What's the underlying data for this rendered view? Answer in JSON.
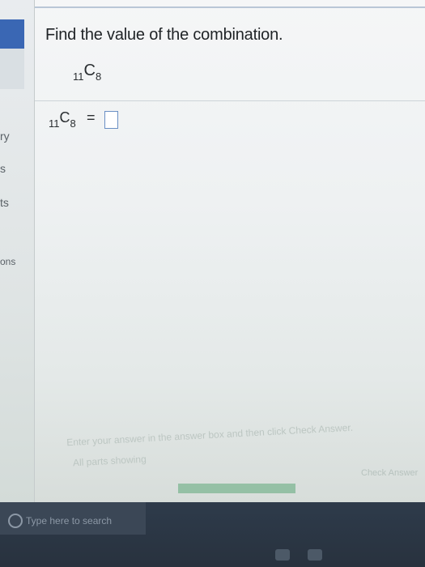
{
  "sidebar": {
    "labels": [
      "ry",
      "s",
      "ts",
      "ons"
    ]
  },
  "question": {
    "prompt": "Find the value of the combination.",
    "expression": {
      "n": "11",
      "symbol": "C",
      "r": "8"
    },
    "answer_label": {
      "n": "11",
      "symbol": "C",
      "r": "8",
      "equals": "="
    },
    "answer_value": ""
  },
  "footer": {
    "help_line1": "Enter your answer in the answer box and then click Check Answer.",
    "help_line2": "All parts showing",
    "check_button": "Check Answer"
  },
  "taskbar": {
    "search_placeholder": "Type here to search"
  }
}
